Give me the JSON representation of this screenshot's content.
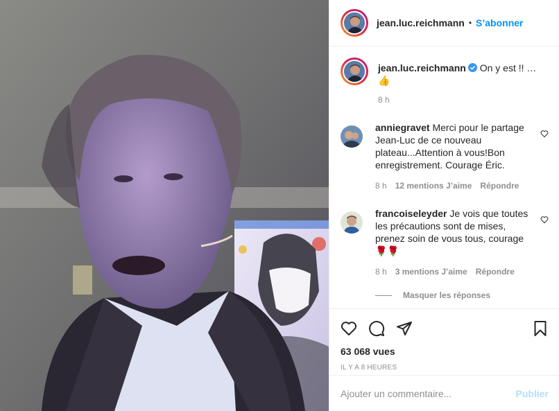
{
  "post": {
    "author": "jean.luc.reichmann",
    "follow_label": "S’abonner",
    "header_separator": "•",
    "caption_text": "On y est !! … 👍",
    "caption_time": "8 h"
  },
  "comments": [
    {
      "username": "anniegravet",
      "text": "Merci pour le partage Jean-Luc de ce nouveau plateau...Attention à vous!Bon enregistrement. Courage Éric.",
      "time": "8 h",
      "likes": "12 mentions J’aime",
      "reply_label": "Répondre",
      "avatar_icon": "user-avatar"
    },
    {
      "username": "francoiseleyder",
      "text": "Je vois que toutes les précautions sont de mises, prenez soin de vous tous, courage 🌹🌹",
      "time": "8 h",
      "likes": "3 mentions J’aime",
      "reply_label": "Répondre",
      "avatar_icon": "user-avatar"
    }
  ],
  "hide_replies_label": "Masquer les réponses",
  "actions": {
    "icons": [
      "heart-icon",
      "comment-icon",
      "share-icon",
      "bookmark-icon"
    ],
    "views": "63 068 vues",
    "posted_ago": "IL Y A 8 HEURES"
  },
  "add_comment": {
    "placeholder": "Ajouter un commentaire...",
    "publish_label": "Publier"
  },
  "colors": {
    "link_blue": "#0095f6",
    "muted_text": "#8e8e8e",
    "verified_blue": "#3897f0"
  }
}
